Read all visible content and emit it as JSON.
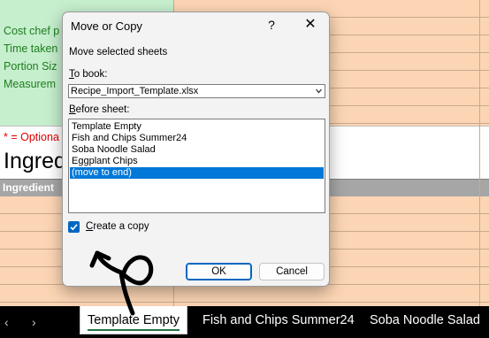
{
  "sheet": {
    "green_lines": [
      "Cost chef p",
      "Time taken",
      "Portion Siz",
      "Measurem"
    ],
    "optional_note": "* = Optiona",
    "section_title": "Ingred",
    "table_header": "Ingredient"
  },
  "dialog": {
    "title": "Move or Copy",
    "help": "?",
    "close": "✕",
    "instruction": "Move selected sheets",
    "to_book_label": "o book:",
    "to_book_key": "T",
    "to_book_value": "Recipe_Import_Template.xlsx",
    "before_sheet_label": "efore sheet:",
    "before_sheet_key": "B",
    "sheets": [
      "Template Empty",
      "Fish and Chips Summer24",
      "Soba Noodle Salad",
      "Eggplant Chips",
      "(move to end)"
    ],
    "selected_index": 4,
    "copy_checked": true,
    "copy_label_key": "C",
    "copy_label": "reate a copy",
    "ok": "OK",
    "cancel": "Cancel"
  },
  "tabs": {
    "prev": "‹",
    "next": "›",
    "items": [
      "Template Empty",
      "Fish and Chips Summer24",
      "Soba Noodle Salad"
    ],
    "active_index": 0
  },
  "colors": {
    "accent": "#0067c0",
    "selection": "#0078d7",
    "green_fill": "#c6efce",
    "orange_fill": "#fcd5b4",
    "active_tab_underline": "#217346"
  }
}
